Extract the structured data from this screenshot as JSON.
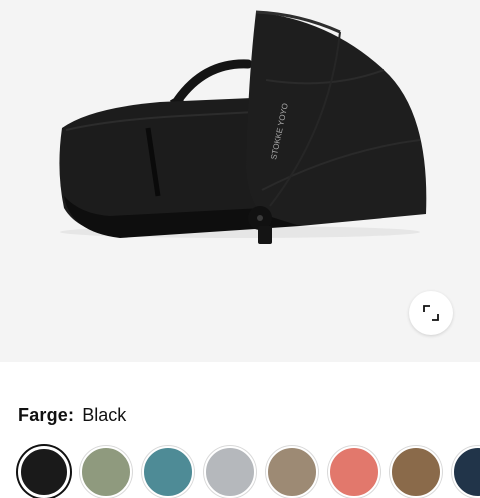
{
  "product": {
    "image_alt": "black bassinet",
    "brand_print": "STOKKE YOYO"
  },
  "expand_icon": "expand-icon",
  "color_selector": {
    "label": "Farge:",
    "selected_value": "Black",
    "swatches": [
      {
        "name": "black",
        "color": "#1a1a1a",
        "selected": true
      },
      {
        "name": "olive",
        "color": "#8f9a7e",
        "selected": false
      },
      {
        "name": "teal",
        "color": "#4e8b96",
        "selected": false
      },
      {
        "name": "grey",
        "color": "#b5b8bc",
        "selected": false
      },
      {
        "name": "taupe",
        "color": "#9d8a74",
        "selected": false
      },
      {
        "name": "coral",
        "color": "#e2786c",
        "selected": false
      },
      {
        "name": "brown",
        "color": "#8a6a4a",
        "selected": false
      },
      {
        "name": "navy",
        "color": "#213449",
        "selected": false
      }
    ]
  }
}
